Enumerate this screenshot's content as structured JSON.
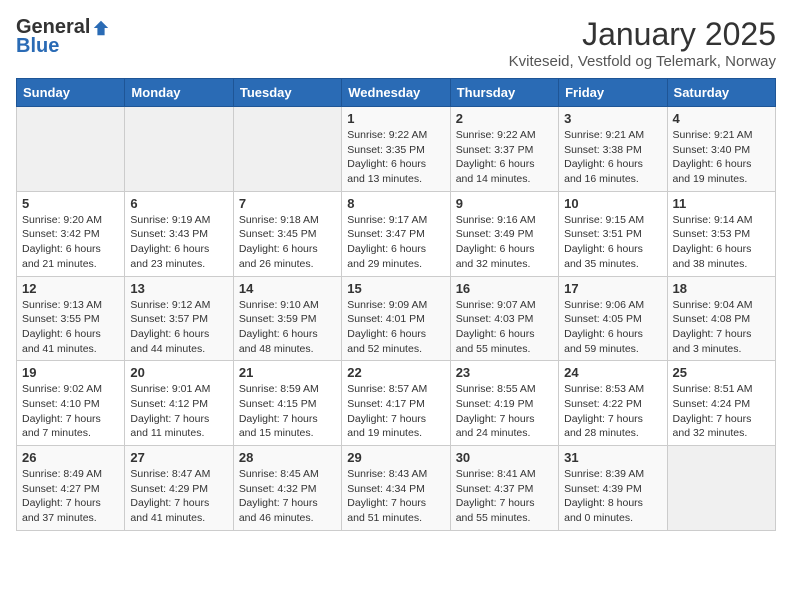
{
  "header": {
    "logo_general": "General",
    "logo_blue": "Blue",
    "month": "January 2025",
    "location": "Kviteseid, Vestfold og Telemark, Norway"
  },
  "weekdays": [
    "Sunday",
    "Monday",
    "Tuesday",
    "Wednesday",
    "Thursday",
    "Friday",
    "Saturday"
  ],
  "weeks": [
    [
      {
        "day": "",
        "info": ""
      },
      {
        "day": "",
        "info": ""
      },
      {
        "day": "",
        "info": ""
      },
      {
        "day": "1",
        "info": "Sunrise: 9:22 AM\nSunset: 3:35 PM\nDaylight: 6 hours\nand 13 minutes."
      },
      {
        "day": "2",
        "info": "Sunrise: 9:22 AM\nSunset: 3:37 PM\nDaylight: 6 hours\nand 14 minutes."
      },
      {
        "day": "3",
        "info": "Sunrise: 9:21 AM\nSunset: 3:38 PM\nDaylight: 6 hours\nand 16 minutes."
      },
      {
        "day": "4",
        "info": "Sunrise: 9:21 AM\nSunset: 3:40 PM\nDaylight: 6 hours\nand 19 minutes."
      }
    ],
    [
      {
        "day": "5",
        "info": "Sunrise: 9:20 AM\nSunset: 3:42 PM\nDaylight: 6 hours\nand 21 minutes."
      },
      {
        "day": "6",
        "info": "Sunrise: 9:19 AM\nSunset: 3:43 PM\nDaylight: 6 hours\nand 23 minutes."
      },
      {
        "day": "7",
        "info": "Sunrise: 9:18 AM\nSunset: 3:45 PM\nDaylight: 6 hours\nand 26 minutes."
      },
      {
        "day": "8",
        "info": "Sunrise: 9:17 AM\nSunset: 3:47 PM\nDaylight: 6 hours\nand 29 minutes."
      },
      {
        "day": "9",
        "info": "Sunrise: 9:16 AM\nSunset: 3:49 PM\nDaylight: 6 hours\nand 32 minutes."
      },
      {
        "day": "10",
        "info": "Sunrise: 9:15 AM\nSunset: 3:51 PM\nDaylight: 6 hours\nand 35 minutes."
      },
      {
        "day": "11",
        "info": "Sunrise: 9:14 AM\nSunset: 3:53 PM\nDaylight: 6 hours\nand 38 minutes."
      }
    ],
    [
      {
        "day": "12",
        "info": "Sunrise: 9:13 AM\nSunset: 3:55 PM\nDaylight: 6 hours\nand 41 minutes."
      },
      {
        "day": "13",
        "info": "Sunrise: 9:12 AM\nSunset: 3:57 PM\nDaylight: 6 hours\nand 44 minutes."
      },
      {
        "day": "14",
        "info": "Sunrise: 9:10 AM\nSunset: 3:59 PM\nDaylight: 6 hours\nand 48 minutes."
      },
      {
        "day": "15",
        "info": "Sunrise: 9:09 AM\nSunset: 4:01 PM\nDaylight: 6 hours\nand 52 minutes."
      },
      {
        "day": "16",
        "info": "Sunrise: 9:07 AM\nSunset: 4:03 PM\nDaylight: 6 hours\nand 55 minutes."
      },
      {
        "day": "17",
        "info": "Sunrise: 9:06 AM\nSunset: 4:05 PM\nDaylight: 6 hours\nand 59 minutes."
      },
      {
        "day": "18",
        "info": "Sunrise: 9:04 AM\nSunset: 4:08 PM\nDaylight: 7 hours\nand 3 minutes."
      }
    ],
    [
      {
        "day": "19",
        "info": "Sunrise: 9:02 AM\nSunset: 4:10 PM\nDaylight: 7 hours\nand 7 minutes."
      },
      {
        "day": "20",
        "info": "Sunrise: 9:01 AM\nSunset: 4:12 PM\nDaylight: 7 hours\nand 11 minutes."
      },
      {
        "day": "21",
        "info": "Sunrise: 8:59 AM\nSunset: 4:15 PM\nDaylight: 7 hours\nand 15 minutes."
      },
      {
        "day": "22",
        "info": "Sunrise: 8:57 AM\nSunset: 4:17 PM\nDaylight: 7 hours\nand 19 minutes."
      },
      {
        "day": "23",
        "info": "Sunrise: 8:55 AM\nSunset: 4:19 PM\nDaylight: 7 hours\nand 24 minutes."
      },
      {
        "day": "24",
        "info": "Sunrise: 8:53 AM\nSunset: 4:22 PM\nDaylight: 7 hours\nand 28 minutes."
      },
      {
        "day": "25",
        "info": "Sunrise: 8:51 AM\nSunset: 4:24 PM\nDaylight: 7 hours\nand 32 minutes."
      }
    ],
    [
      {
        "day": "26",
        "info": "Sunrise: 8:49 AM\nSunset: 4:27 PM\nDaylight: 7 hours\nand 37 minutes."
      },
      {
        "day": "27",
        "info": "Sunrise: 8:47 AM\nSunset: 4:29 PM\nDaylight: 7 hours\nand 41 minutes."
      },
      {
        "day": "28",
        "info": "Sunrise: 8:45 AM\nSunset: 4:32 PM\nDaylight: 7 hours\nand 46 minutes."
      },
      {
        "day": "29",
        "info": "Sunrise: 8:43 AM\nSunset: 4:34 PM\nDaylight: 7 hours\nand 51 minutes."
      },
      {
        "day": "30",
        "info": "Sunrise: 8:41 AM\nSunset: 4:37 PM\nDaylight: 7 hours\nand 55 minutes."
      },
      {
        "day": "31",
        "info": "Sunrise: 8:39 AM\nSunset: 4:39 PM\nDaylight: 8 hours\nand 0 minutes."
      },
      {
        "day": "",
        "info": ""
      }
    ]
  ]
}
